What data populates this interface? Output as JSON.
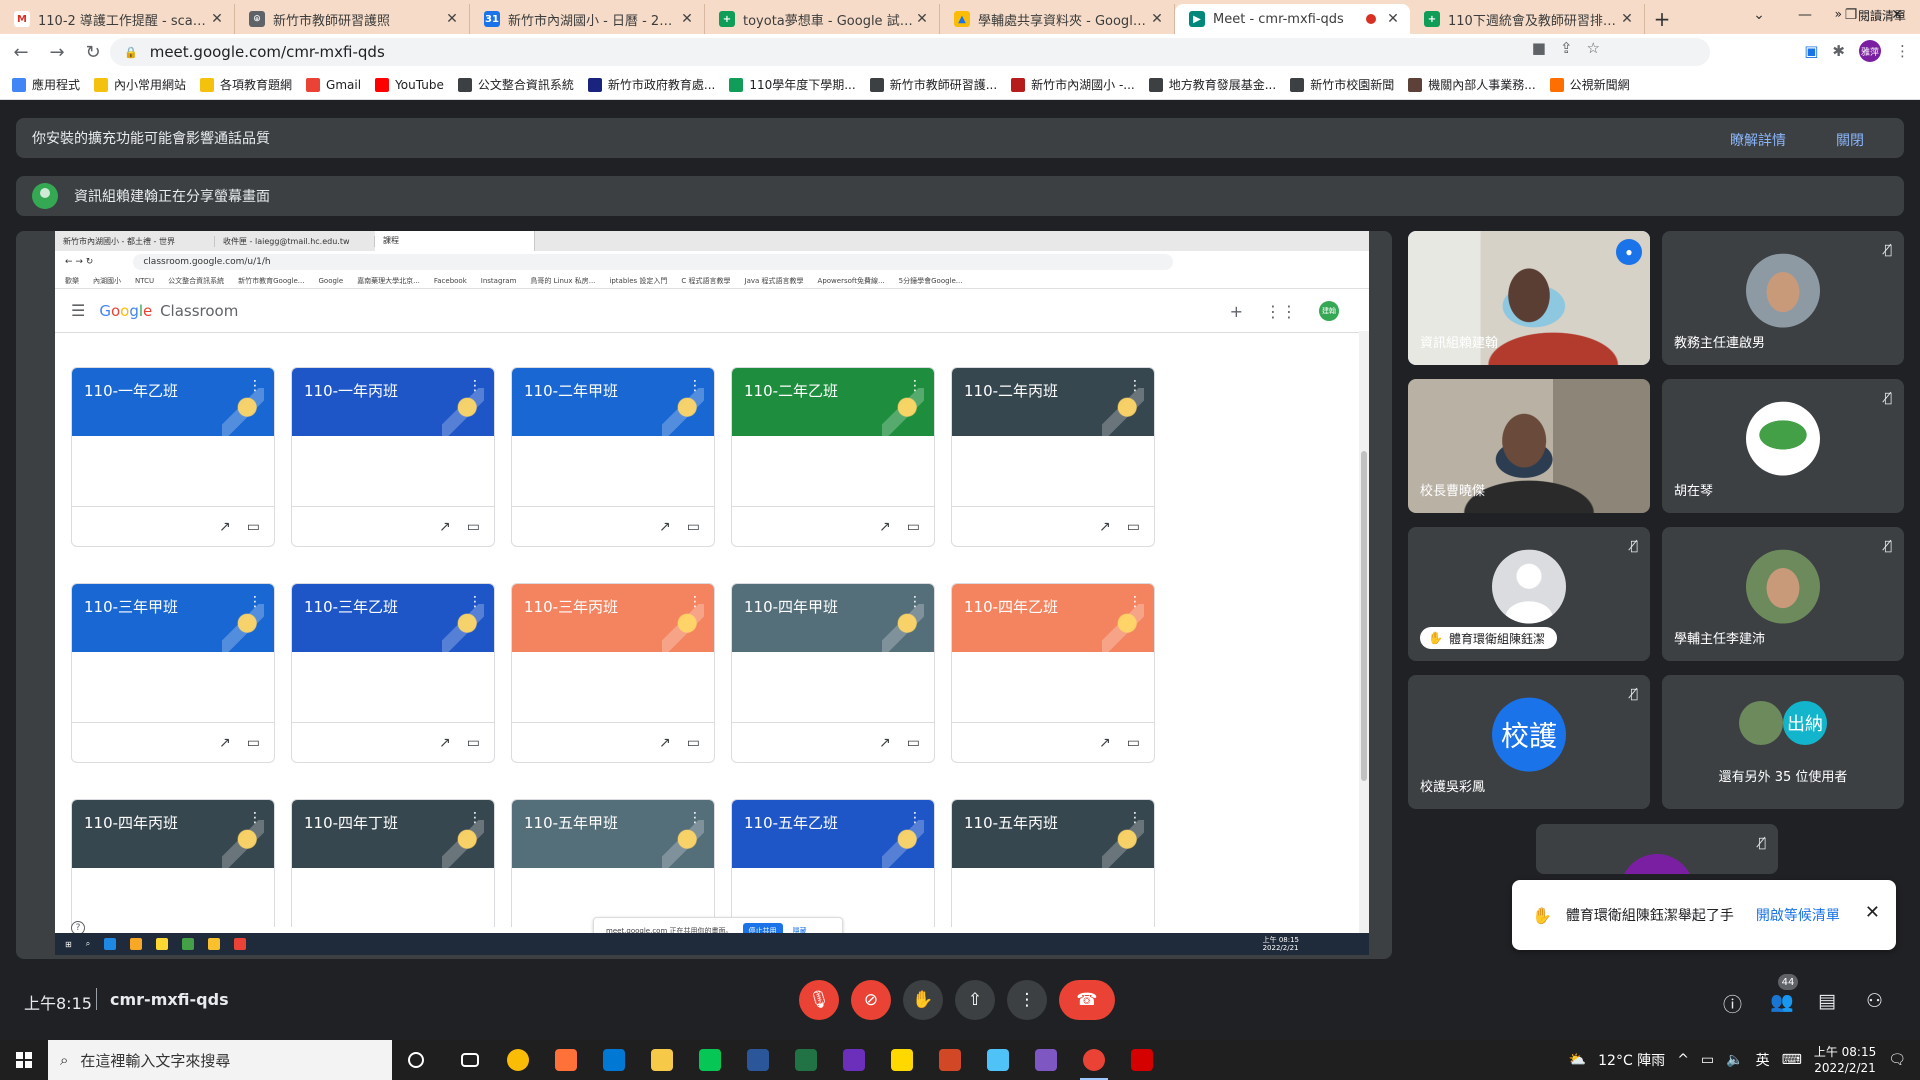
{
  "browser": {
    "tabs": [
      {
        "label": "110-2 導護工作提醒 - scarlet25",
        "color": "#ffffff",
        "glyph": "M",
        "glyph_color": "#d93025",
        "active": false
      },
      {
        "label": "新竹市教師研習護照",
        "color": "#5f6368",
        "glyph": "⌾",
        "glyph_color": "#ffffff",
        "active": false
      },
      {
        "label": "新竹市內湖國小 - 日曆 - 2022年",
        "color": "#1a73e8",
        "glyph": "31",
        "glyph_color": "#ffffff",
        "active": false
      },
      {
        "label": "toyota夢想車 - Google 試算表",
        "color": "#0f9d58",
        "glyph": "+",
        "glyph_color": "#ffffff",
        "active": false
      },
      {
        "label": "學輔處共享資料夾 - Google 雲端",
        "color": "#fbbc05",
        "glyph": "▲",
        "glyph_color": "#1a73e8",
        "active": false
      },
      {
        "label": "Meet - cmr-mxfi-qds",
        "color": "#00897b",
        "glyph": "▶",
        "glyph_color": "#ffffff",
        "active": true
      },
      {
        "label": "110下週統會及教師研習排定表",
        "color": "#0f9d58",
        "glyph": "+",
        "glyph_color": "#ffffff",
        "active": false
      }
    ],
    "url": "meet.google.com/cmr-mxfi-qds",
    "profile_initials": "雅萍",
    "bookmarks": [
      {
        "label": "應用程式",
        "color": "#4285f4"
      },
      {
        "label": "內小常用網站",
        "color": "#f4c20d"
      },
      {
        "label": "各項教育題網",
        "color": "#f4c20d"
      },
      {
        "label": "Gmail",
        "color": "#ea4335"
      },
      {
        "label": "YouTube",
        "color": "#ff0000"
      },
      {
        "label": "公文整合資訊系統",
        "color": "#3c4043"
      },
      {
        "label": "新竹市政府教育處...",
        "color": "#1a237e"
      },
      {
        "label": "110學年度下學期...",
        "color": "#0f9d58"
      },
      {
        "label": "新竹市教師研習護...",
        "color": "#3c4043"
      },
      {
        "label": "新竹市內湖國小 -...",
        "color": "#b71c1c"
      },
      {
        "label": "地方教育發展基金...",
        "color": "#3c4043"
      },
      {
        "label": "新竹市校園新聞",
        "color": "#3c4043"
      },
      {
        "label": "機關內部人事業務...",
        "color": "#5d4037"
      },
      {
        "label": "公視新聞網",
        "color": "#ff6f00"
      }
    ],
    "reading_list": "閱讀清單",
    "more": "»"
  },
  "meet": {
    "banner_extensions": "你安裝的擴充功能可能會影響通話品質",
    "banner_learn_more": "瞭解詳情",
    "banner_close": "關閉",
    "presenting_banner": "資訊組賴建翰正在分享螢幕畫面",
    "meeting_time": "上午8:15",
    "meeting_code": "cmr-mxfi-qds",
    "people_count": "44",
    "toast": {
      "message": "體育環衛組陳鈺潔舉起了手",
      "action": "開啟等候清單"
    },
    "participants": [
      {
        "name": "資訊組賴建翰",
        "type": "video",
        "speaking": true,
        "muted": false
      },
      {
        "name": "教務主任連啟男",
        "type": "photo",
        "muted": true,
        "color": "#8d9aa3"
      },
      {
        "name": "校長曹曉傑",
        "type": "video",
        "muted": false
      },
      {
        "name": "胡在琴",
        "type": "photo",
        "muted": true,
        "color": "#ffffff"
      },
      {
        "name": "體育環衛組陳鈺潔",
        "type": "avatar",
        "muted": true,
        "hand": true,
        "color": "#dadce0"
      },
      {
        "name": "學輔主任李建沛",
        "type": "photo",
        "muted": true,
        "color": "#6d8a5c"
      },
      {
        "name": "校護吳彩鳳",
        "type": "letter",
        "muted": true,
        "letter": "校護",
        "color": "#1a73e8"
      },
      {
        "name": "還有另外 35 位使用者",
        "type": "group",
        "muted": false,
        "letter": "出納",
        "color": "#12b5cb"
      }
    ],
    "icons": {
      "mic": "mic-off-icon",
      "cam": "videocam-off-icon",
      "hand": "raise-hand-icon",
      "present": "present-screen-icon",
      "more": "more-vert-icon",
      "hangup": "call-end-icon"
    }
  },
  "shared_screen": {
    "tabs": [
      "新竹市內湖國小 - 都土禮 - 世界",
      "收件匣 - laiegg@tmail.hc.edu.tw",
      "課程"
    ],
    "url": "classroom.google.com/u/1/h",
    "bookmarks": [
      "歡樂",
      "內湖國小",
      "NTCU",
      "公文整合資訊系統",
      "新竹市教育Google...",
      "Google",
      "嘉南藥理大學北京...",
      "Facebook",
      "Instagram",
      "鳥哥的 Linux 私房...",
      "iptables 設定入門",
      "C 程式語言教學",
      "Java 程式語言教學",
      "Apowersoft免費線...",
      "5分鐘學會Google..."
    ],
    "app_name_parts": [
      "G",
      "o",
      "o",
      "g",
      "l",
      "e"
    ],
    "app_suffix": "Classroom",
    "avatar": "建翰",
    "classes": [
      {
        "name": "110-一年乙班",
        "color": "#1967d2"
      },
      {
        "name": "110-一年丙班",
        "color": "#1e56c8"
      },
      {
        "name": "110-二年甲班",
        "color": "#1967d2"
      },
      {
        "name": "110-二年乙班",
        "color": "#1e8e3e"
      },
      {
        "name": "110-二年丙班",
        "color": "#37474f"
      },
      {
        "name": "110-三年甲班",
        "color": "#1967d2"
      },
      {
        "name": "110-三年乙班",
        "color": "#1e56c8"
      },
      {
        "name": "110-三年丙班",
        "color": "#f4845f"
      },
      {
        "name": "110-四年甲班",
        "color": "#546e7a"
      },
      {
        "name": "110-四年乙班",
        "color": "#f4845f"
      },
      {
        "name": "110-四年丙班",
        "color": "#37474f"
      },
      {
        "name": "110-四年丁班",
        "color": "#37474f"
      },
      {
        "name": "110-五年甲班",
        "color": "#546e7a"
      },
      {
        "name": "110-五年乙班",
        "color": "#1e56c8"
      },
      {
        "name": "110-五年丙班",
        "color": "#37474f"
      }
    ],
    "share_bar_text": "meet.google.com 正在共用你的畫面。",
    "share_stop": "停止共用",
    "share_hide": "隱藏",
    "clock_time": "上午 08:15",
    "clock_date": "2022/2/21"
  },
  "taskbar": {
    "search_placeholder": "在這裡輸入文字來搜尋",
    "weather": "12°C 陣雨",
    "ime": "英",
    "time": "上午 08:15",
    "date": "2022/2/21",
    "apps": [
      {
        "name": "task-view",
        "color": "#1f1f1f"
      },
      {
        "name": "chrome",
        "color": "#fbbc05"
      },
      {
        "name": "firefox",
        "color": "#ff7139"
      },
      {
        "name": "people",
        "color": "#0078d4"
      },
      {
        "name": "explorer",
        "color": "#f7c948"
      },
      {
        "name": "line",
        "color": "#06c755"
      },
      {
        "name": "word",
        "color": "#2b579a"
      },
      {
        "name": "excel",
        "color": "#217346"
      },
      {
        "name": "video",
        "color": "#6b2fbb"
      },
      {
        "name": "sticky",
        "color": "#ffd800"
      },
      {
        "name": "powerpoint",
        "color": "#d24726"
      },
      {
        "name": "boat",
        "color": "#4fc3f7"
      },
      {
        "name": "obsidian",
        "color": "#7e57c2"
      },
      {
        "name": "chrome-active",
        "color": "#ea4335"
      },
      {
        "name": "acrobat",
        "color": "#d50000"
      }
    ]
  }
}
